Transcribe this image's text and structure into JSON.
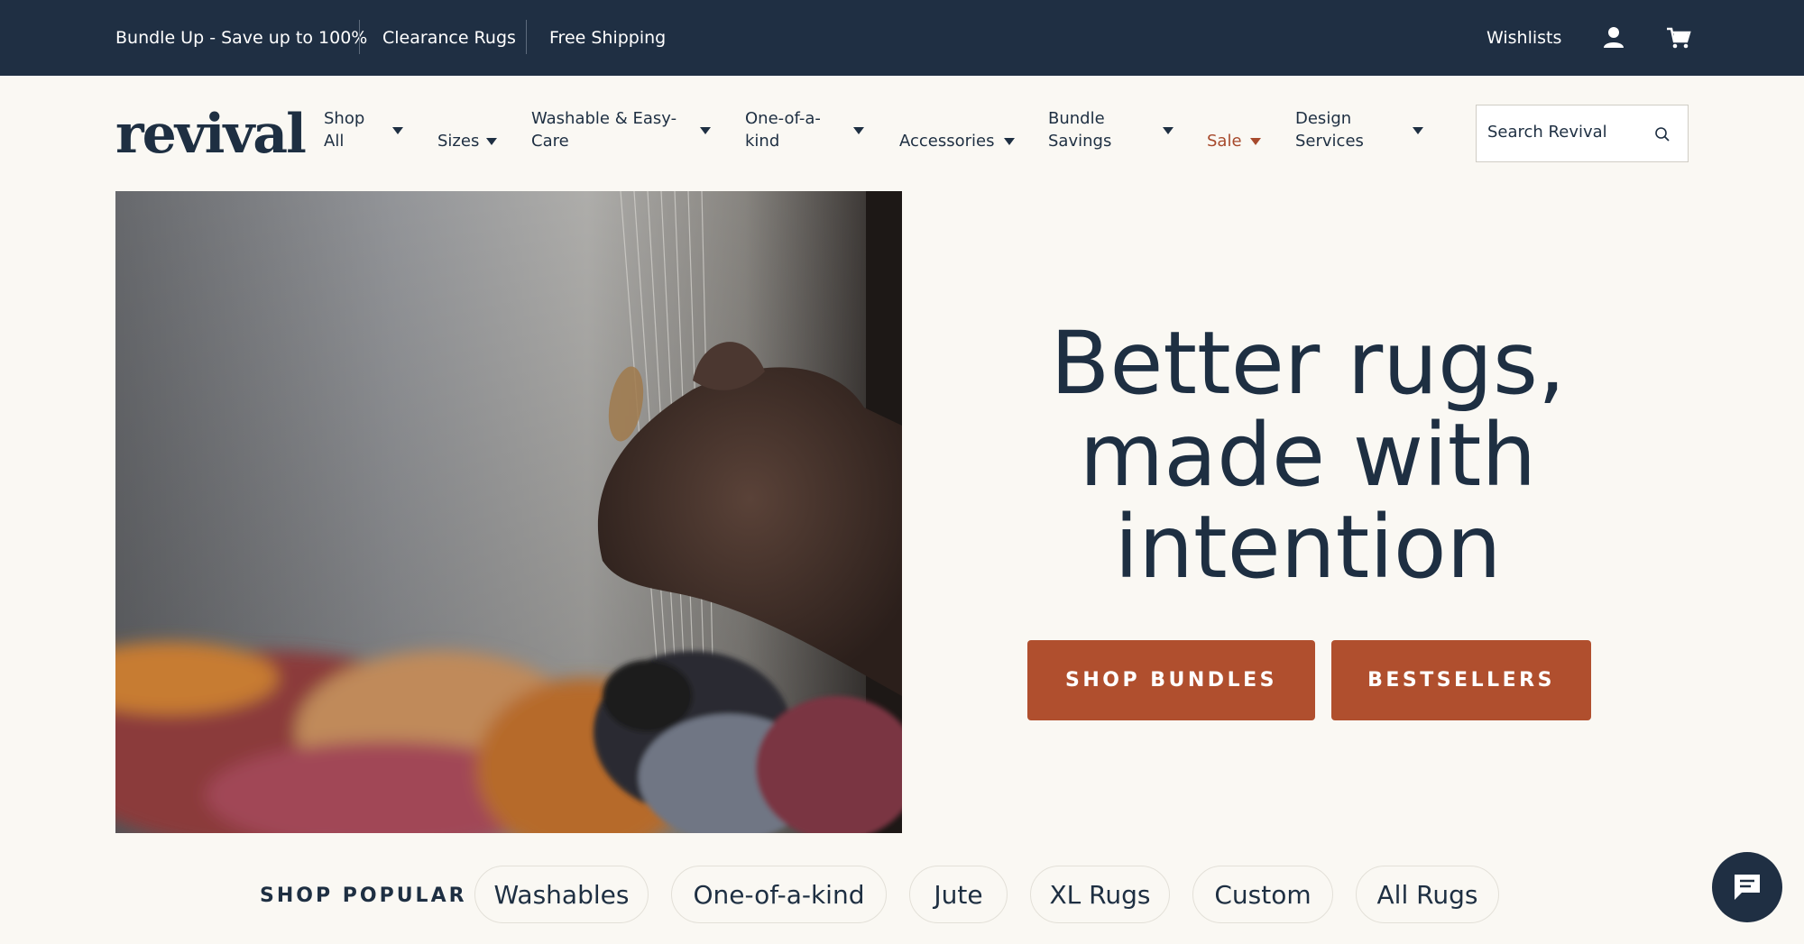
{
  "topbar": {
    "promos": [
      "Bundle Up - Save up to 100%",
      "Clearance Rugs",
      "Free Shipping"
    ],
    "wishlists": "Wishlists",
    "account_icon": "user-icon",
    "cart_icon": "cart-icon"
  },
  "nav": {
    "logo": "revival",
    "items": [
      {
        "line1": "Shop",
        "line2": "All"
      },
      {
        "line1": "",
        "line2": "Sizes"
      },
      {
        "line1": "Washable & Easy-",
        "line2": "Care"
      },
      {
        "line1": "One-of-a-",
        "line2": "kind"
      },
      {
        "line1": "",
        "line2": "Accessories"
      },
      {
        "line1": "Bundle",
        "line2": "Savings"
      },
      {
        "line1": "",
        "line2": "Sale"
      },
      {
        "line1": "Design",
        "line2": "Services"
      }
    ],
    "search_placeholder": "Search Revival"
  },
  "hero": {
    "title_line1": "Better rugs,",
    "title_line2": "made with",
    "title_line3": "intention",
    "primary_button": "SHOP BUNDLES",
    "secondary_button": "BESTSELLERS"
  },
  "popular": {
    "label": "SHOP POPULAR",
    "pills": [
      "Washables",
      "One-of-a-kind",
      "Jute",
      "XL Rugs",
      "Custom",
      "All Rugs"
    ]
  },
  "colors": {
    "navy": "#1f2f43",
    "accent": "#b04f2e",
    "sale": "#a74a2c",
    "background": "#faf8f3"
  }
}
